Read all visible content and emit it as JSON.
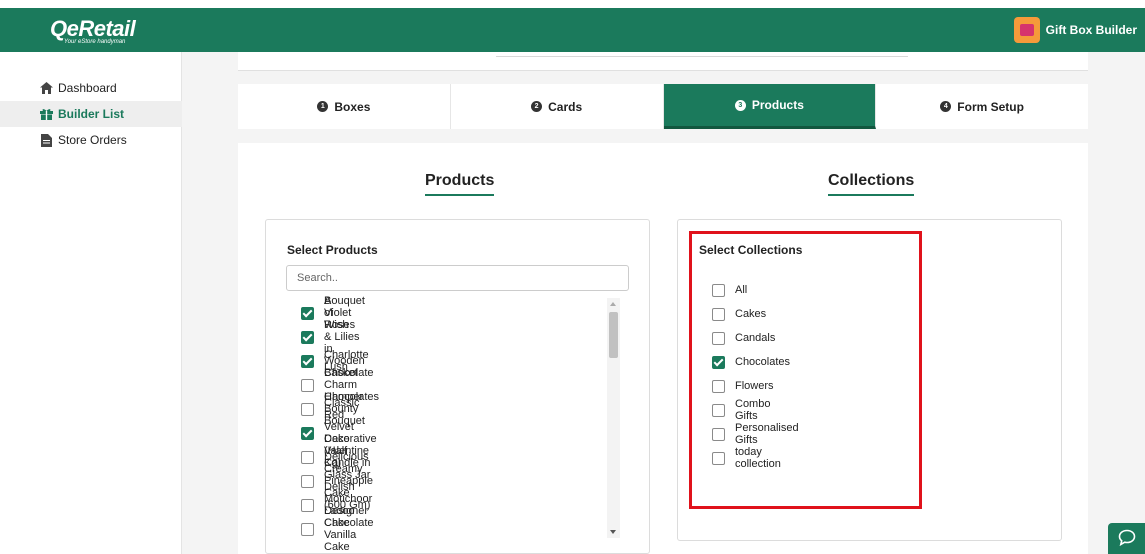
{
  "header": {
    "logo_text": "QeRetail",
    "logo_tagline": "Your eStore handyman",
    "app_name": "Gift Box Builder",
    "app_icon": "gift-box-icon"
  },
  "sidebar": {
    "items": [
      {
        "label": "Dashboard",
        "icon": "home-icon",
        "active": false
      },
      {
        "label": "Builder List",
        "icon": "gift-icon",
        "active": true
      },
      {
        "label": "Store Orders",
        "icon": "document-icon",
        "active": false
      }
    ]
  },
  "steps": [
    {
      "number": "1",
      "label": "Boxes",
      "active": false
    },
    {
      "number": "2",
      "label": "Cards",
      "active": false
    },
    {
      "number": "3",
      "label": "Products",
      "active": true
    },
    {
      "number": "4",
      "label": "Form Setup",
      "active": false
    }
  ],
  "products_section": {
    "title": "Products",
    "panel_label": "Select Products",
    "search_placeholder": "Search..",
    "items": [
      {
        "label": "A Violet Wish",
        "checked": true
      },
      {
        "label": "Bouquet of Roses & Lilies in Wooden Basket",
        "checked": true
      },
      {
        "label": "Charlotte Lush",
        "checked": true
      },
      {
        "label": "Chocolate Charm Hamper",
        "checked": false
      },
      {
        "label": "Chocolates Bounty Bouquet",
        "checked": false
      },
      {
        "label": "Classic Red Velvet Cake (Half Kg)",
        "checked": true
      },
      {
        "label": "Decorative Valentine Candle in Glass Jar",
        "checked": false
      },
      {
        "label": "Delicious Creamy Pineapple Cake (600 Gm)",
        "checked": false
      },
      {
        "label": "Delish Motichoor Ladoo Cake",
        "checked": false
      },
      {
        "label": "Designer Chocolate Vanilla Cake",
        "checked": false
      }
    ]
  },
  "collections_section": {
    "title": "Collections",
    "panel_label": "Select Collections",
    "items": [
      {
        "label": "All",
        "checked": false
      },
      {
        "label": "Cakes",
        "checked": false
      },
      {
        "label": "Candals",
        "checked": false
      },
      {
        "label": "Chocolates",
        "checked": true
      },
      {
        "label": "Flowers",
        "checked": false
      },
      {
        "label": "Combo Gifts",
        "checked": false
      },
      {
        "label": "Personalised Gifts",
        "checked": false
      },
      {
        "label": "today collection",
        "checked": false
      }
    ]
  },
  "colors": {
    "brand": "#1b7a5c",
    "highlight": "#e0121b"
  }
}
